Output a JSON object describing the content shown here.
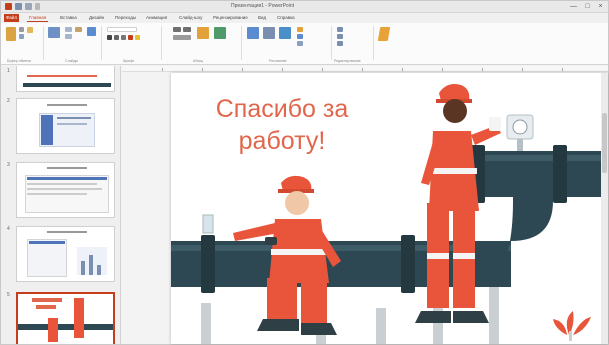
{
  "window": {
    "title": "Презентация1 - PowerPoint",
    "min_glyph": "—",
    "max_glyph": "□",
    "close_glyph": "×"
  },
  "tabs": [
    {
      "label": "Файл"
    },
    {
      "label": "Главная"
    },
    {
      "label": "Вставка"
    },
    {
      "label": "Дизайн"
    },
    {
      "label": "Переходы"
    },
    {
      "label": "Анимация"
    },
    {
      "label": "Слайд-шоу"
    },
    {
      "label": "Рецензирование"
    },
    {
      "label": "Вид"
    },
    {
      "label": "Справка"
    }
  ],
  "ribbon_groups": [
    {
      "label": "Буфер обмена"
    },
    {
      "label": "Слайды"
    },
    {
      "label": "Шрифт"
    },
    {
      "label": "Абзац"
    },
    {
      "label": "Рисование"
    },
    {
      "label": "Редактирование"
    }
  ],
  "slides": [
    {
      "number": "1"
    },
    {
      "number": "2"
    },
    {
      "number": "3"
    },
    {
      "number": "4"
    },
    {
      "number": "5"
    }
  ],
  "current_slide": {
    "title": "Спасибо за работу!"
  },
  "colors": {
    "accent": "#c43e1c",
    "title_text": "#e0664c",
    "pipe": "#2e4853",
    "uniform": "#e8553a"
  }
}
